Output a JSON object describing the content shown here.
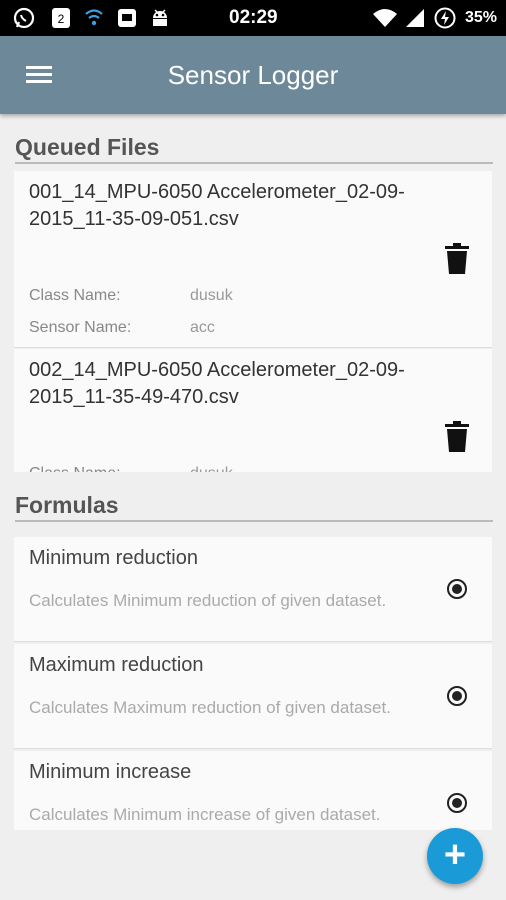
{
  "status_bar": {
    "time": "02:29",
    "battery_pct": "35%",
    "icons": [
      "whatsapp-icon",
      "notification-count-icon",
      "wifi-calling-icon",
      "shield-icon",
      "android-icon",
      "wifi-icon",
      "signal-icon",
      "alarm-icon",
      "battery-icon"
    ],
    "notification_count": "2"
  },
  "app_bar": {
    "title": "Sensor Logger",
    "menu_icon": "hamburger-menu-icon"
  },
  "queued_files": {
    "section_title": "Queued Files",
    "labels": {
      "class_name": "Class Name:",
      "sensor_name": "Sensor Name:"
    },
    "items": [
      {
        "file_name": "001_14_MPU-6050 Accelerometer_02-09-2015_11-35-09-051.csv",
        "class_name": "dusuk",
        "sensor_name": "acc",
        "delete_icon": "trash-icon"
      },
      {
        "file_name": "002_14_MPU-6050 Accelerometer_02-09-2015_11-35-49-470.csv",
        "class_name": "dusuk",
        "sensor_name": "",
        "delete_icon": "trash-icon"
      }
    ]
  },
  "formulas": {
    "section_title": "Formulas",
    "items": [
      {
        "name": "Minimum reduction",
        "description": "Calculates Minimum reduction of given dataset.",
        "selected": true
      },
      {
        "name": "Maximum reduction",
        "description": "Calculates Maximum reduction of given dataset.",
        "selected": true
      },
      {
        "name": "Minimum increase",
        "description": "Calculates Minimum increase of given dataset.",
        "selected": true
      }
    ]
  },
  "fab": {
    "label": "+",
    "icon": "plus-icon"
  },
  "colors": {
    "app_bar": "#6d8899",
    "fab": "#1a9ad6",
    "background": "#efefef",
    "card": "#fafafa"
  }
}
